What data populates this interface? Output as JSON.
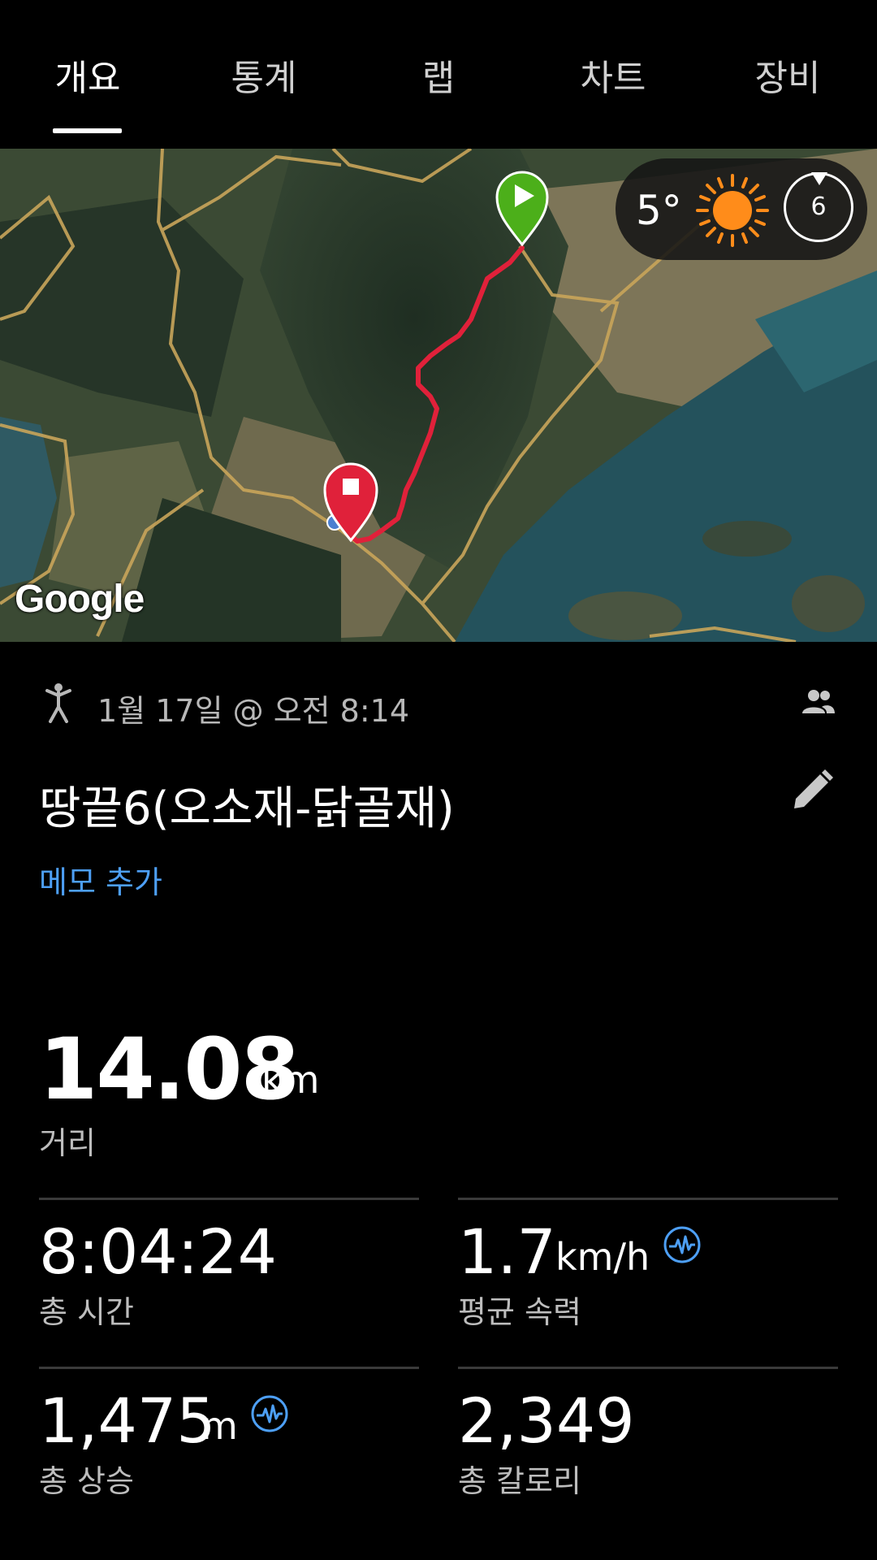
{
  "tabs": [
    {
      "label": "개요",
      "active": true
    },
    {
      "label": "통계",
      "active": false
    },
    {
      "label": "랩",
      "active": false
    },
    {
      "label": "차트",
      "active": false
    },
    {
      "label": "장비",
      "active": false
    }
  ],
  "map": {
    "provider_logo": "Google",
    "start_marker_icon": "play-icon",
    "end_marker_icon": "stop-icon",
    "route_color": "#e0213a"
  },
  "weather": {
    "temperature": "5°",
    "condition_icon": "sun-icon",
    "uv_index": "6"
  },
  "activity": {
    "type_icon": "walking-icon",
    "date": "1월 17일 @ 오전 8:14",
    "title": "땅끝6(오소재-닭골재)",
    "add_memo": "메모 추가"
  },
  "distance": {
    "value": "14.08",
    "unit": "km",
    "label": "거리"
  },
  "stats": {
    "total_time": {
      "value": "8:04:24",
      "label": "총 시간"
    },
    "avg_speed": {
      "value": "1.7",
      "unit": "km/h",
      "label": "평균 속력"
    },
    "total_ascent": {
      "value": "1,475",
      "unit": "m",
      "label": "총 상승"
    },
    "total_calories": {
      "value": "2,349",
      "label": "총 칼로리"
    }
  },
  "colors": {
    "background": "#000000",
    "accent_blue": "#4d9ff5",
    "start_green": "#4caf1a",
    "end_red": "#e0213a",
    "sun_orange": "#ff8c1a"
  }
}
